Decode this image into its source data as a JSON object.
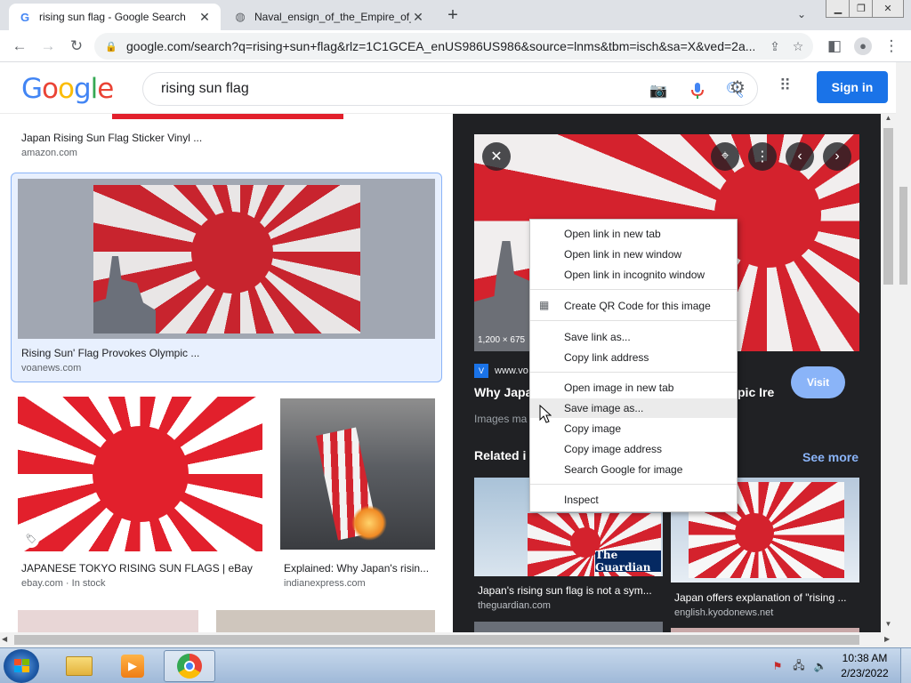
{
  "browser": {
    "tabs": [
      {
        "title": "rising sun flag - Google Search",
        "active": true
      },
      {
        "title": "Naval_ensign_of_the_Empire_of_",
        "active": false
      }
    ],
    "new_tab": "+",
    "url": "google.com/search?q=rising+sun+flag&rlz=1C1GCEA_enUS986US986&source=lnms&tbm=isch&sa=X&ved=2a..."
  },
  "google": {
    "logo": [
      "G",
      "o",
      "o",
      "g",
      "l",
      "e"
    ],
    "logo_colors": [
      "#4285f4",
      "#ea4335",
      "#fbbc05",
      "#4285f4",
      "#34a853",
      "#ea4335"
    ],
    "query": "rising sun flag",
    "signin": "Sign in"
  },
  "results": [
    {
      "title": "Japan Rising Sun Flag Sticker Vinyl ...",
      "source": "amazon.com"
    },
    {
      "title": "Rising Sun' Flag Provokes Olympic ...",
      "source": "voanews.com"
    },
    {
      "title": "JAPANESE TOKYO RISING SUN FLAGS | eBay",
      "source": "ebay.com · In stock"
    },
    {
      "title": "Explained: Why Japan's risin...",
      "source": "indianexpress.com"
    }
  ],
  "preview": {
    "dimensions": "1,200 × 675",
    "source_site": "www.vo",
    "title_left": "Why Japa",
    "title_right": "pic Ire",
    "meta": "Images ma",
    "visit": "Visit",
    "related_label": "Related i",
    "see_more": "See more",
    "related": [
      {
        "title": "Japan's rising sun flag is not a sym...",
        "source": "theguardian.com",
        "badge": "The Guardian"
      },
      {
        "title": "Japan offers explanation of \"rising ...",
        "source": "english.kyodonews.net"
      }
    ]
  },
  "context_menu": {
    "items": [
      "Open link in new tab",
      "Open link in new window",
      "Open link in incognito window",
      "Create QR Code for this image",
      "Save link as...",
      "Copy link address",
      "Open image in new tab",
      "Save image as...",
      "Copy image",
      "Copy image address",
      "Search Google for image",
      "Inspect"
    ],
    "hovered": "Save image as..."
  },
  "taskbar": {
    "time": "10:38 AM",
    "date": "2/23/2022"
  },
  "colors": {
    "flag_red": "#e2202c",
    "accent_blue": "#1a73e8",
    "panel_bg": "#202124"
  }
}
